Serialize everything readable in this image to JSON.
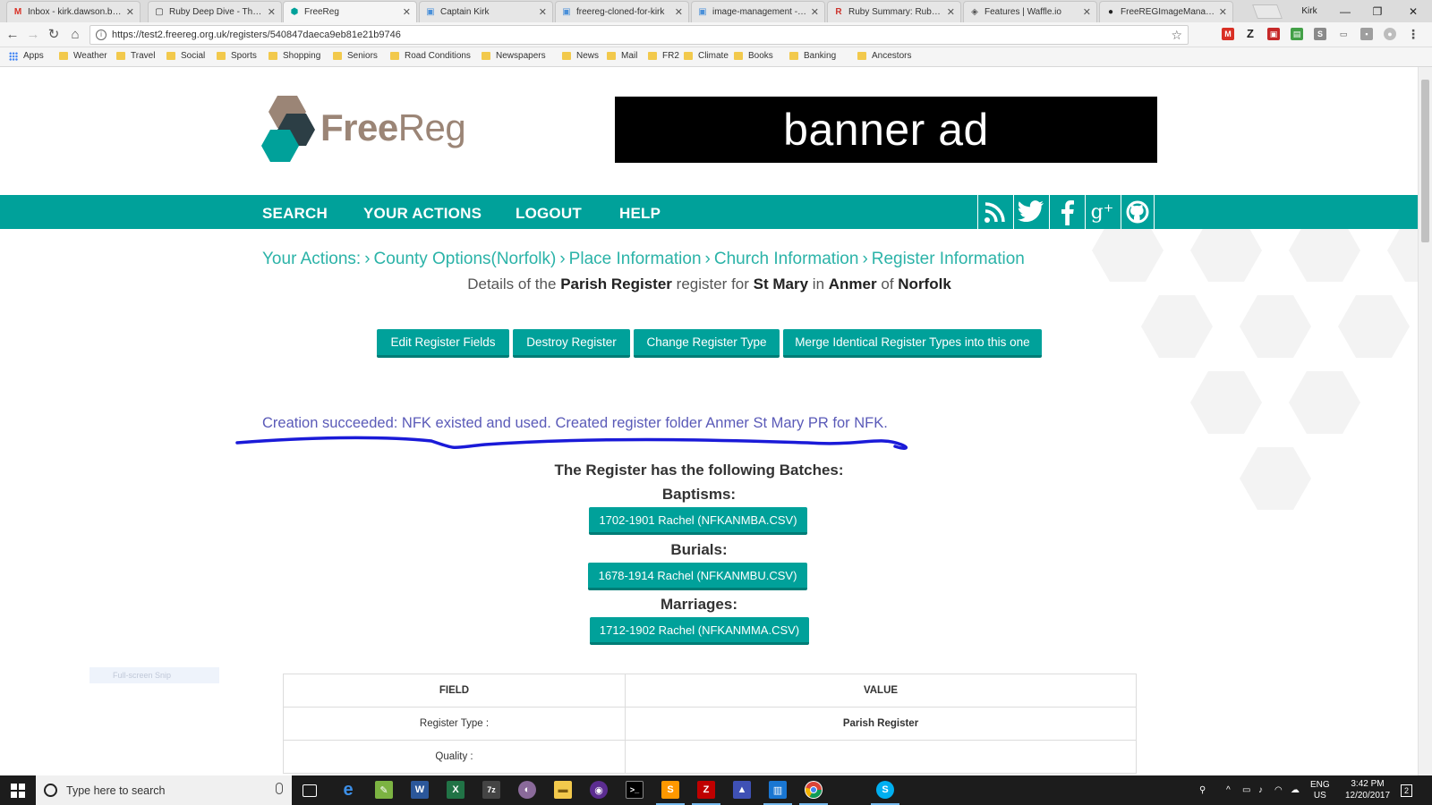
{
  "browser": {
    "tabs": [
      {
        "label": "Inbox - kirk.dawson.bc@...",
        "favicon": "gmail-icon",
        "color": "#d93025",
        "glyph": "M"
      },
      {
        "label": "Ruby Deep Dive - The I...",
        "favicon": "page-icon",
        "color": "#333333",
        "glyph": "▢"
      },
      {
        "label": "FreeReg",
        "favicon": "freereg-icon",
        "color": "#00a19a",
        "glyph": "⬢",
        "active": true
      },
      {
        "label": "Captain Kirk",
        "favicon": "doc-icon",
        "color": "#4a90d9",
        "glyph": "▣"
      },
      {
        "label": "freereg-cloned-for-kirk",
        "favicon": "doc-icon",
        "color": "#4a90d9",
        "glyph": "▣"
      },
      {
        "label": "image-management - C...",
        "favicon": "doc-icon",
        "color": "#4a90d9",
        "glyph": "▣"
      },
      {
        "label": "Ruby Summary: Ruby S...",
        "favicon": "ruby-icon",
        "color": "#cc342d",
        "glyph": "R"
      },
      {
        "label": "Features | Waffle.io",
        "favicon": "waffle-icon",
        "color": "#555555",
        "glyph": "◈"
      },
      {
        "label": "FreeREGImageManage...",
        "favicon": "github-icon",
        "color": "#222222",
        "glyph": "●"
      }
    ],
    "user_label": "Kirk",
    "url": "https://test2.freereg.org.uk/registers/540847daeca9eb81e21b9746",
    "bookmarks": [
      "Apps",
      "Weather",
      "Travel",
      "Social",
      "Sports",
      "Shopping",
      "Seniors",
      "Road Conditions",
      "Newspapers",
      "News",
      "Mail",
      "FR2",
      "Climate",
      "Books",
      "Banking",
      "Ancestors"
    ]
  },
  "site": {
    "logo_free": "Free",
    "logo_reg": "Reg",
    "banner": "banner ad",
    "nav": [
      "SEARCH",
      "YOUR ACTIONS",
      "LOGOUT",
      "HELP"
    ],
    "social": [
      "rss-icon",
      "twitter-icon",
      "facebook-icon",
      "google-plus-icon",
      "github-icon"
    ],
    "breadcrumb": [
      "Your Actions:",
      "County Options(Norfolk)",
      "Place Information",
      "Church Information",
      "Register Information"
    ],
    "breadcrumb_sep": "›",
    "details": {
      "prefix": "Details of the",
      "register_type": "Parish Register",
      "mid1": "register for",
      "church": "St Mary",
      "mid2": "in",
      "place": "Anmer",
      "mid3": "of",
      "county": "Norfolk"
    },
    "actions": [
      "Edit Register Fields",
      "Destroy Register",
      "Change Register Type",
      "Merge Identical Register Types into this one"
    ],
    "flash": "Creation succeeded: NFK existed and used. Created register folder Anmer St Mary PR for NFK.",
    "batches_title": "The Register has the following Batches:",
    "batches": [
      {
        "heading": "Baptisms:",
        "button": "1702-1901 Rachel (NFKANMBA.CSV)"
      },
      {
        "heading": "Burials:",
        "button": "1678-1914 Rachel (NFKANMBU.CSV)"
      },
      {
        "heading": "Marriages:",
        "button": "1712-1902 Rachel (NFKANMMA.CSV)"
      }
    ],
    "snip_label": "Full-screen Snip",
    "table": {
      "headers": [
        "FIELD",
        "VALUE"
      ],
      "rows": [
        {
          "field": "Register Type :",
          "value": "Parish Register"
        },
        {
          "field": "Quality :",
          "value": ""
        }
      ]
    }
  },
  "taskbar": {
    "search_placeholder": "Type here to search",
    "lang": "ENG",
    "region": "US",
    "time": "3:42 PM",
    "date": "12/20/2017",
    "notifications": "2"
  },
  "colors": {
    "teal": "#00a19a",
    "teal_dark": "#007c76",
    "flash": "#5a5ab8",
    "breadcrumb": "#2bb3a8",
    "logo": "#9b8576"
  }
}
